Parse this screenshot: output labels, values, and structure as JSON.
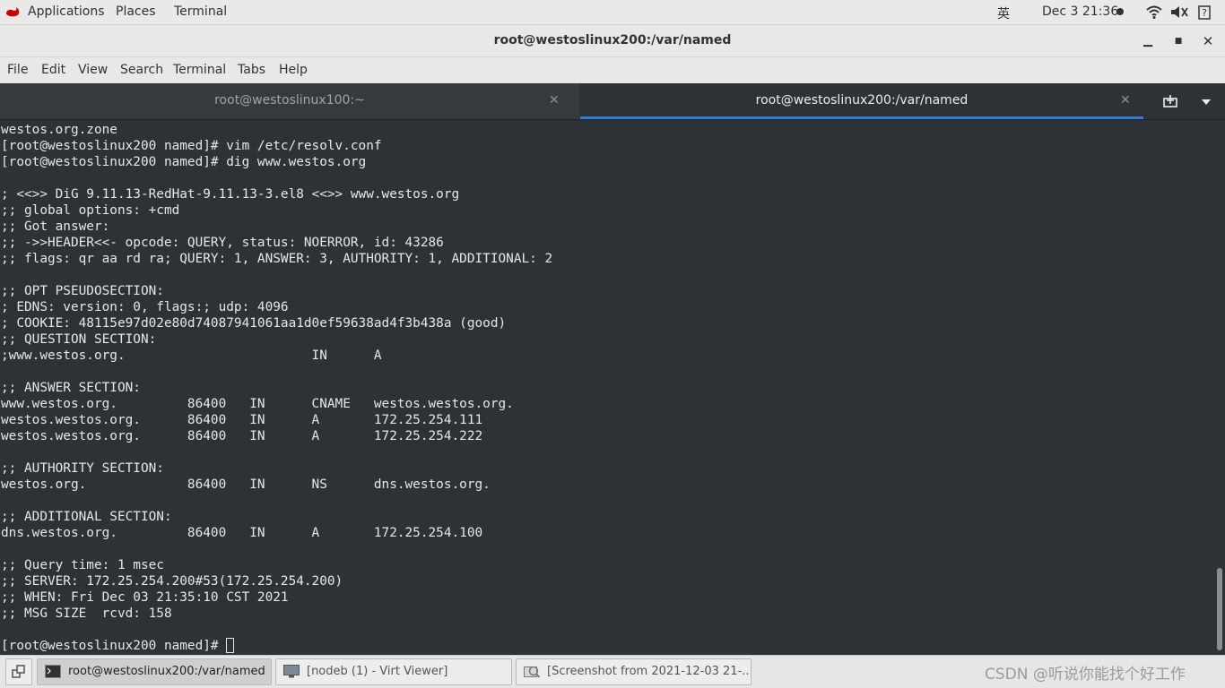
{
  "topbar": {
    "menu": [
      "Applications",
      "Places",
      "Terminal"
    ],
    "input_method": "英",
    "datetime": "Dec 3  21:36",
    "icons": [
      "wifi-icon",
      "volume-icon",
      "help-icon"
    ]
  },
  "window": {
    "title": "root@westoslinux200:/var/named",
    "buttons": [
      "minimize",
      "maximize",
      "close"
    ]
  },
  "menubar": [
    "File",
    "Edit",
    "View",
    "Search",
    "Terminal",
    "Tabs",
    "Help"
  ],
  "tabs": [
    {
      "label": "root@westoslinux100:~",
      "active": false
    },
    {
      "label": "root@westoslinux200:/var/named",
      "active": true
    }
  ],
  "terminal": {
    "lines": [
      "westos.org.zone",
      "[root@westoslinux200 named]# vim /etc/resolv.conf",
      "[root@westoslinux200 named]# dig www.westos.org",
      "",
      "; <<>> DiG 9.11.13-RedHat-9.11.13-3.el8 <<>> www.westos.org",
      ";; global options: +cmd",
      ";; Got answer:",
      ";; ->>HEADER<<- opcode: QUERY, status: NOERROR, id: 43286",
      ";; flags: qr aa rd ra; QUERY: 1, ANSWER: 3, AUTHORITY: 1, ADDITIONAL: 2",
      "",
      ";; OPT PSEUDOSECTION:",
      "; EDNS: version: 0, flags:; udp: 4096",
      "; COOKIE: 48115e97d02e80d74087941061aa1d0ef59638ad4f3b438a (good)",
      ";; QUESTION SECTION:",
      ";www.westos.org.                        IN      A",
      "",
      ";; ANSWER SECTION:",
      "www.westos.org.         86400   IN      CNAME   westos.westos.org.",
      "westos.westos.org.      86400   IN      A       172.25.254.111",
      "westos.westos.org.      86400   IN      A       172.25.254.222",
      "",
      ";; AUTHORITY SECTION:",
      "westos.org.             86400   IN      NS      dns.westos.org.",
      "",
      ";; ADDITIONAL SECTION:",
      "dns.westos.org.         86400   IN      A       172.25.254.100",
      "",
      ";; Query time: 1 msec",
      ";; SERVER: 172.25.254.200#53(172.25.254.200)",
      ";; WHEN: Fri Dec 03 21:35:10 CST 2021",
      ";; MSG SIZE  rcvd: 158",
      ""
    ],
    "prompt": "[root@westoslinux200 named]# "
  },
  "taskbar": {
    "items": [
      {
        "label": "root@westoslinux200:/var/named",
        "active": true,
        "icon": "terminal-icon"
      },
      {
        "label": "[nodeb (1) - Virt Viewer]",
        "active": false,
        "icon": "monitor-icon"
      },
      {
        "label": "[Screenshot from 2021-12-03 21-...",
        "active": false,
        "icon": "screenshot-icon"
      }
    ],
    "watermark": "CSDN @听说你能找个好工作"
  },
  "colors": {
    "terminal_bg": "#2c3235",
    "terminal_fg": "#e6e8e8",
    "tab_accent": "#3d7bc2",
    "chrome_bg": "#e8e8e7"
  }
}
